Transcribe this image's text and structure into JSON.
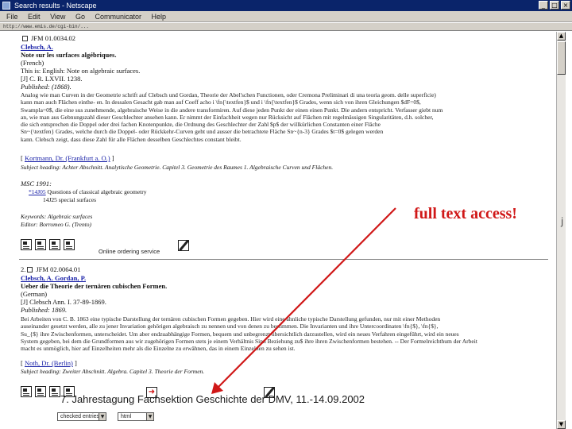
{
  "window": {
    "title": "Search results - Netscape",
    "buttons": [
      "_",
      "□",
      "×"
    ]
  },
  "menu": [
    "File",
    "Edit",
    "View",
    "Go",
    "Communicator",
    "Help"
  ],
  "location": {
    "url": "http://www.emis.de/cgi-bin/..."
  },
  "record1": {
    "id_line": "JFM 01.0034.02",
    "author": "Clebsch, A.",
    "title_fr": "Note sur les surfaces algébriques.",
    "lang": "(French)",
    "english_title": "This is: English: Note on algebraic surfaces.",
    "source": "[J] C. R. LXVII. 1238.",
    "published_label": "Published: (1868).",
    "abstract": [
      "Analog wie man Curven in der Geometrie schrift auf Clebsch und Gordan, Theorie der Abel'schen Functionen, oder Cremona Preliminari di una teoria geom. delle superficie)",
      "kann man auch Flächen einthe- en. In dessalen Gesacht gab man auf Coeff acho i \\fn{\\textfen}$ und i \\fn{\\textfen}$ Grades, wenn sich von ihren Gleichungen $dF=0$,",
      "Swampla=0$, die eine sus zunehmende, algebraische Weise in die andere transformiren. Auf diese jeden Punkt der einen einen Punkt. Die andern entspricht. Verfasser giebt num",
      "an, wie man aus Gebnungszahl dieser Geschlechter ansehen kann. Er nimmt der Einfachheit wegen nur Rücksicht auf Flächen mit regelmässigen Singularitäten, d.h. solcher,",
      "die sich entsprechen die Doppel oder drei fachen Knotenpunkte, die Ordnung des Geschlechter der Zahl $p$ der willkürlichen Constanten einer Fläche",
      "Sn~{\\textfen} Grades, welche durch die Doppel- oder Rückkehr-Curven geht und ausser die betrachtete Fläche Sn~{n-3} Grades $t=0$ gelegen werden",
      "kann. Clebsch zeigt, dass diese Zahl für alle Flächen desselben Geschlechtes constant bleibt."
    ],
    "reviewer": "Kortmann, Dr. (Frankfurt a. O.)",
    "subject_heading": "Subject heading: Achter Abschnitt. Analytische Geometrie. Capitel 3. Geometrie des Raumes 1. Algebraische Curven und Flächen.",
    "msc_label": "MSC 1991:",
    "msc_code": "*14J05",
    "msc_desc": "Questions of classical algebraic geometry",
    "msc_sub": "14J25 special surfaces",
    "keywords": "Keywords: Algebraic surfaces",
    "editor": "Editor: Borromeo G. (Trento)",
    "online_label": "Online ordering service"
  },
  "record2": {
    "number": "2.",
    "id_line": "JFM 02.0064.01",
    "author": "Clebsch, A. Gordan, P.",
    "title_de": "Ueber die Theorie der ternären cubischen Formen.",
    "lang": "(German)",
    "source": "[J] Clebsch Ann. I. 37-89-1869.",
    "published_label": "Published: 1869.",
    "abstract": [
      "Bei Arbeiten von C. B. 1863 eine typische Darstellung der ternären cubischen Formen gegeben. Hier wird eine ähnliche typische Darstellung gefunden, nur mit einer Methoden",
      "auseinander gesetzt werden, alle zu jener Invariation gehörigen algebraisch zu nennen und von denen zu bestimmen. Die Invarianten und ihre Untercoordinaten \\fn{$}, \\fn{$},",
      "Su_{$} ihre Zwischenformen, unterscheidet. Um aber endzuabhängige Formen, bequem und unbegrenzt übersichtlich darzustellen, wird ein neues Verfahren eingeführt, wird ein neues",
      "System gegeben, bei dem die Grundformen aus wir zugehörigen Formen stets je einem Verhältnis Sinn Beziehung zu$ ihre ihren Zwischenformen bestehen. -- Der Formelreichthum der Arbeit",
      "macht es unmöglich, hier auf Einzelheiten mehr als die Einzelne zu erwähnen, das in einem Einzelnen zu sehen ist."
    ],
    "reviewer": "Noth, Dr. (Berlin)",
    "subject_heading": "Subject heading: Zweiter Abschnitt. Algebra. Capitel 3. Theorie der Formen.",
    "select_format": "checked entries",
    "select_type": "html"
  },
  "annotation": {
    "callout": "full text access!",
    "edge_mark": "j",
    "caption": "7. Jahrestagung Fachsektion Geschichte der DMV, 11.-14.09.2002"
  },
  "scrollbar": {
    "up": "▲",
    "down": "▼"
  },
  "colors": {
    "link_blue": "#1a22a8",
    "callout_red": "#d01818",
    "titlebar": "#0a246a",
    "chrome": "#d4d0c8"
  }
}
